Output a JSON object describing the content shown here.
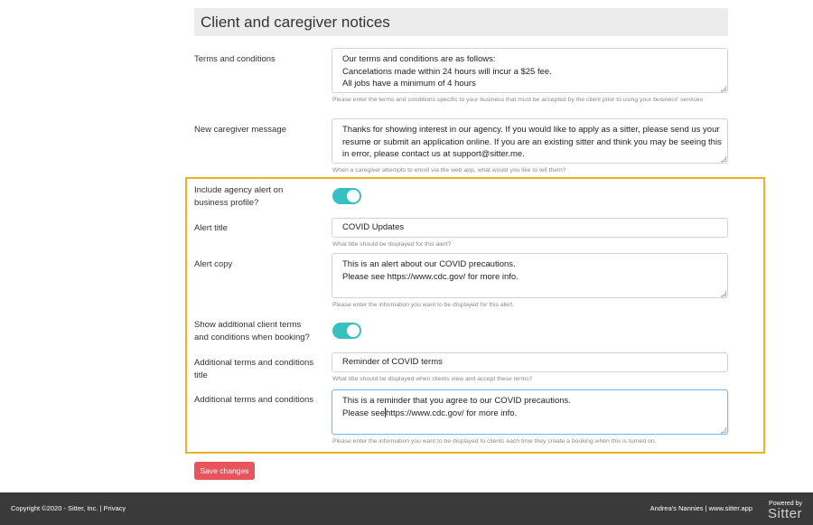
{
  "section": {
    "title": "Client and caregiver notices"
  },
  "terms": {
    "label": "Terms and conditions",
    "lines": [
      "Our terms and conditions are as follows:",
      "Cancelations made within 24 hours will incur a $25 fee.",
      "All jobs have a minimum of 4 hours"
    ],
    "help": "Please enter the terms and conditions specific to your business that must be accepted by the client prior to using your business' services"
  },
  "caregiver_message": {
    "label": "New caregiver message",
    "lines": [
      "Thanks for showing interest in our agency.  If you would like to apply as a sitter, please send us your",
      "resume or submit an application online.  If you are an existing sitter and think you may be seeing this",
      "in error, please contact us at support@sitter.me."
    ],
    "help": "When a caregiver attempts to enroll via the web app, what would you like to tell them?"
  },
  "agency_alert": {
    "label": "Include agency alert on business profile?",
    "enabled": true
  },
  "alert_title": {
    "label": "Alert title",
    "value": "COVID Updates",
    "help": "What title should be displayed for this alert?"
  },
  "alert_copy": {
    "label": "Alert copy",
    "lines": [
      "This is an alert about our COVID precautions.",
      "Please see https://www.cdc.gov/ for more info."
    ],
    "help": "Please enter the information you want to be displayed for this alert."
  },
  "additional_terms_toggle": {
    "label": "Show additional client terms and conditions when booking?",
    "enabled": true
  },
  "additional_terms_title": {
    "label": "Additional terms and conditions title",
    "value": "Reminder of COVID terms",
    "help": "What title should be displayed when clients view and accept these terms?"
  },
  "additional_terms": {
    "label": "Additional terms and conditions",
    "line1": "This is a reminder that you agree to our COVID precautions.",
    "line2_before_caret": "Please see",
    "line2_after_caret": "https://www.cdc.gov/ for more info.",
    "help": "Please enter the information you want to be displayed to clients each time they create a booking when this is turned on."
  },
  "save_label": "Save changes",
  "footer": {
    "copyright": "Copyright ©2020 - Sitter, Inc. | ",
    "privacy": "Privacy",
    "agency": "Andrea's Nannies | www.sitter.app",
    "powered_by": "Powered by",
    "logo": "Sitter"
  },
  "colors": {
    "accent_toggle": "#37c0c0",
    "save_button": "#e8545c",
    "highlight": "#f0b31c",
    "footer_bg": "#3a3a3a"
  }
}
